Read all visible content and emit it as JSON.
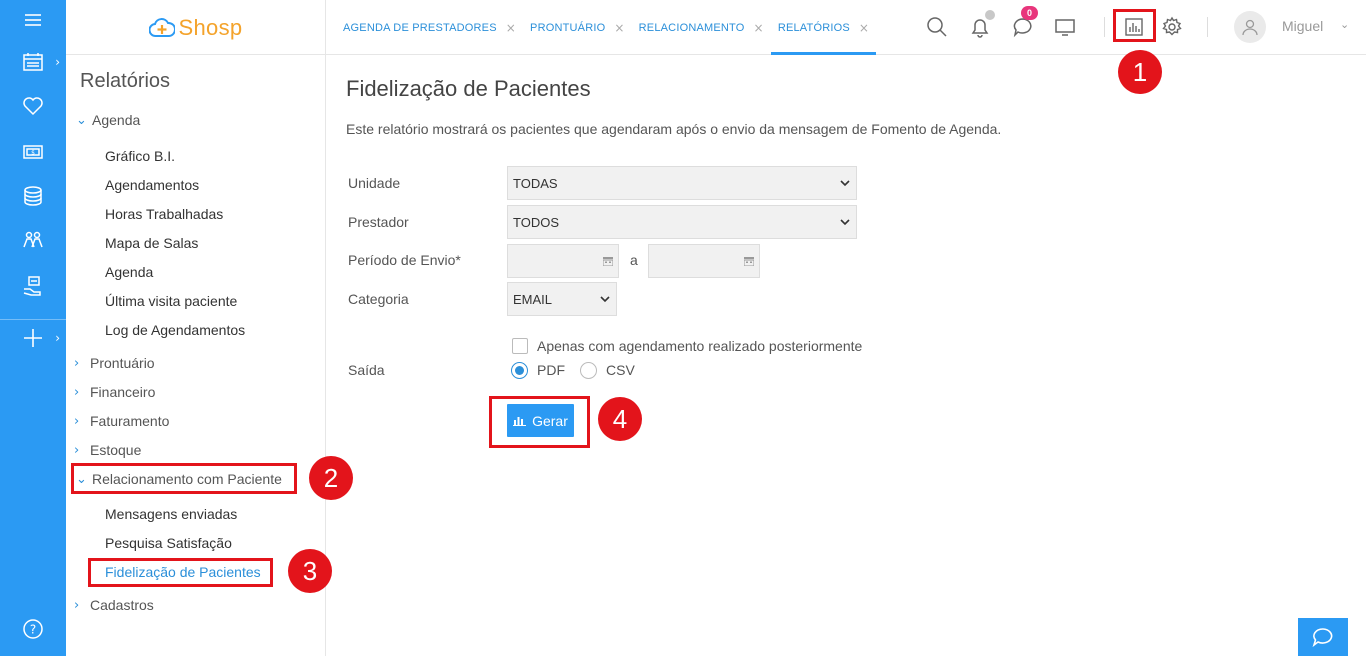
{
  "brand": {
    "logo_text": "Shosp",
    "logo_color": "#f4a32b",
    "rail_color": "#2b9af3",
    "accent": "#2b8fd9",
    "highlight": "#e3141b"
  },
  "rail": {
    "items": [
      {
        "icon": "hamburger-menu-icon"
      },
      {
        "icon": "calendar-icon",
        "has_submenu": true
      },
      {
        "icon": "heart-icon"
      },
      {
        "icon": "money-icon"
      },
      {
        "icon": "database-icon"
      },
      {
        "icon": "people-icon"
      },
      {
        "icon": "hand-service-icon"
      },
      {
        "icon": "plus-icon",
        "has_submenu": true
      },
      {
        "icon": "help-icon"
      }
    ]
  },
  "tabs": [
    {
      "label": "AGENDA DE PRESTADORES",
      "active": false
    },
    {
      "label": "PRONTUÁRIO",
      "active": false
    },
    {
      "label": "RELACIONAMENTO",
      "active": false
    },
    {
      "label": "RELATÓRIOS",
      "active": true
    }
  ],
  "tab_close_glyph": "×",
  "header": {
    "notifications_badge": "0",
    "user_name": "Miguel"
  },
  "sidebar": {
    "title": "Relatórios",
    "agenda": {
      "label": "Agenda",
      "items": [
        "Gráfico B.I.",
        "Agendamentos",
        "Horas Trabalhadas",
        "Mapa de Salas",
        "Agenda",
        "Última visita paciente",
        "Log de Agendamentos"
      ]
    },
    "groups": [
      "Prontuário",
      "Financeiro",
      "Faturamento",
      "Estoque"
    ],
    "relacionamento": {
      "label": "Relacionamento com Paciente",
      "items": [
        "Mensagens enviadas",
        "Pesquisa Satisfação",
        "Fidelização de Pacientes"
      ],
      "active_item": "Fidelização de Pacientes"
    },
    "cadastros": "Cadastros"
  },
  "main": {
    "title": "Fidelização de Pacientes",
    "description": "Este relatório mostrará os pacientes que agendaram após o envio da mensagem de Fomento de Agenda.",
    "fields": {
      "unidade": {
        "label": "Unidade",
        "value": "TODAS"
      },
      "prestador": {
        "label": "Prestador",
        "value": "TODOS"
      },
      "periodo": {
        "label": "Período de Envio*",
        "separator": "a",
        "start": "",
        "end": ""
      },
      "categoria": {
        "label": "Categoria",
        "value": "EMAIL"
      }
    },
    "checkbox_label": "Apenas com agendamento realizado posteriormente",
    "checkbox_checked": false,
    "saida": {
      "label": "Saída",
      "options": [
        "PDF",
        "CSV"
      ],
      "selected": "PDF"
    },
    "generate_label": "Gerar"
  },
  "annotations": [
    "1",
    "2",
    "3",
    "4"
  ]
}
